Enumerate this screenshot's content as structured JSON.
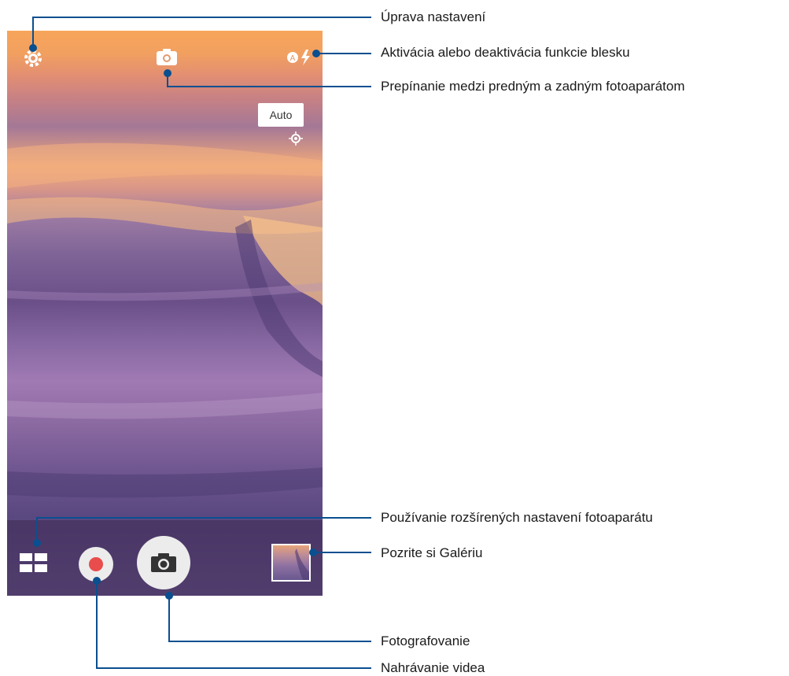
{
  "camera": {
    "scene_mode_label": "Auto",
    "icons": {
      "settings": "gear-icon",
      "switch_camera": "switch-camera-icon",
      "flash": "flash-auto-icon",
      "exposure": "exposure-icon",
      "modes": "grid-icon",
      "video": "record-icon",
      "shutter": "camera-icon",
      "gallery": "gallery-thumbnail"
    },
    "colors": {
      "record": "#e84c4c",
      "button_bg": "#ececec",
      "callout_line": "#0a4f8f"
    }
  },
  "callouts": [
    {
      "id": "settings",
      "text": "Úprava nastavení"
    },
    {
      "id": "flash",
      "text": "Aktivácia alebo deaktivácia funkcie blesku"
    },
    {
      "id": "switch",
      "text": "Prepínanie medzi predným a zadným fotoaparátom"
    },
    {
      "id": "advanced",
      "text": "Používanie rozšírených nastavení fotoaparátu"
    },
    {
      "id": "gallery",
      "text": "Pozrite si Galériu"
    },
    {
      "id": "photo",
      "text": "Fotografovanie"
    },
    {
      "id": "video",
      "text": "Nahrávanie videa"
    }
  ]
}
